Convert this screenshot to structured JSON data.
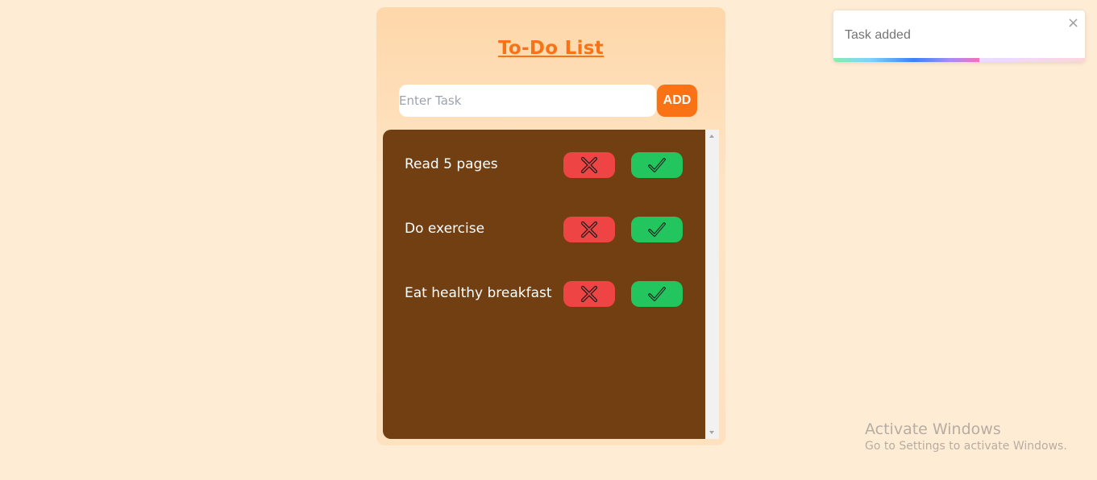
{
  "app": {
    "title": "To-Do List",
    "input": {
      "placeholder": "Enter Task",
      "value": ""
    },
    "add_label": "ADD"
  },
  "tasks": [
    {
      "label": "Read 5 pages"
    },
    {
      "label": "Do exercise"
    },
    {
      "label": "Eat healthy breakfast"
    }
  ],
  "icons": {
    "delete": "cross-icon",
    "complete": "check-icon"
  },
  "toast": {
    "message": "Task added",
    "close": "×",
    "progress": 0.58
  },
  "watermark": {
    "title": "Activate Windows",
    "subtitle": "Go to Settings to activate Windows."
  },
  "colors": {
    "page_bg": "#ffecd5",
    "accent": "#f97316",
    "list_bg": "#713f12",
    "delete": "#ef4444",
    "complete": "#22c55e"
  }
}
